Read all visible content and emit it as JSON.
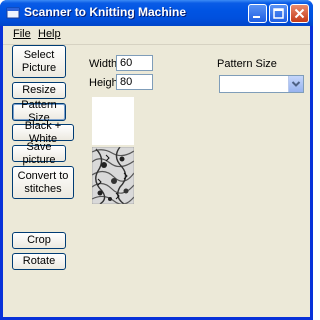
{
  "window": {
    "title": "Scanner to Knitting Machine"
  },
  "menu": {
    "file": "File",
    "help": "Help"
  },
  "buttons": {
    "select_picture": "Select Picture",
    "resize": "Resize",
    "pattern_size": "Pattern Size",
    "black_white": "Black + White",
    "save_picture": "Save picture",
    "convert": "Convert to stitches",
    "crop": "Crop",
    "rotate": "Rotate"
  },
  "fields": {
    "width_label": "Width",
    "width_value": "60",
    "height_label": "Height",
    "height_value": "80",
    "pattern_size_label": "Pattern Size",
    "pattern_size_value": ""
  },
  "colors": {
    "titlebar": "#0054e3",
    "background": "#ece9d8"
  }
}
